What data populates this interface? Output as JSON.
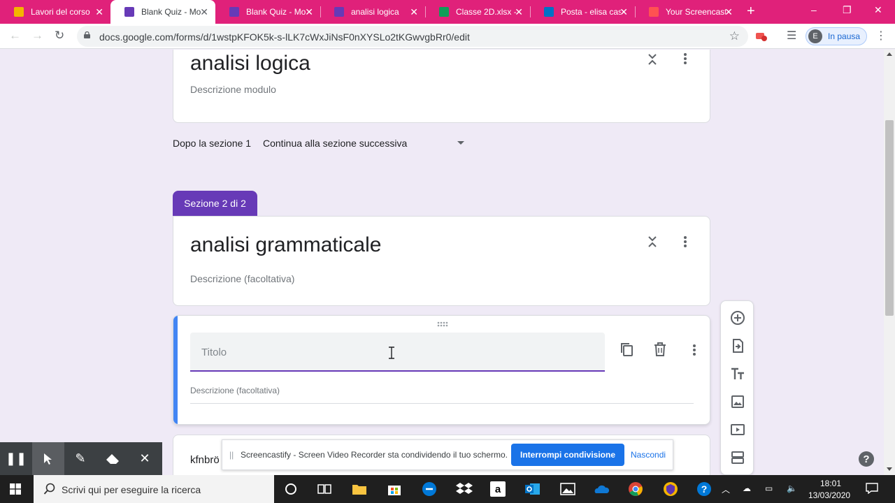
{
  "browser": {
    "tabs": [
      {
        "label": "Lavori del corso",
        "icon_color": "#f4b400"
      },
      {
        "label": "Blank Quiz - Mo",
        "icon_color": "#673ab7"
      },
      {
        "label": "Blank Quiz - Mo",
        "icon_color": "#673ab7"
      },
      {
        "label": "analisi logica",
        "icon_color": "#673ab7"
      },
      {
        "label": "Classe 2D.xlsx -",
        "icon_color": "#0f9d58"
      },
      {
        "label": "Posta - elisa cas",
        "icon_color": "#0072c6"
      },
      {
        "label": "Your Screencast",
        "icon_color": "#ff5252"
      }
    ],
    "new_tab_glyph": "+",
    "url": "docs.google.com/forms/d/1wstpKFOK5k-s-lLK7cWxJiNsF0nXYSLo2tKGwvgbRr0/edit",
    "profile_initial": "E",
    "profile_status": "In pausa",
    "accent_color": "#e0217a"
  },
  "form": {
    "section1": {
      "title": "analisi logica",
      "description_placeholder": "Descrizione modulo"
    },
    "after_section": {
      "label": "Dopo la sezione 1",
      "value": "Continua alla sezione successiva"
    },
    "section2": {
      "badge": "Sezione 2 di 2",
      "title": "analisi grammaticale",
      "description_placeholder": "Descrizione (facoltativa)"
    },
    "active_item": {
      "title_placeholder": "Titolo",
      "description_placeholder": "Descrizione (facoltativa)"
    },
    "next_item_text": "kfnbrö",
    "theme_color": "#673ab7",
    "active_bar_color": "#4285f4"
  },
  "toolbar_icons": [
    "add-question-icon",
    "import-questions-icon",
    "add-title-icon",
    "add-image-icon",
    "add-video-icon",
    "add-section-icon"
  ],
  "help_glyph": "?",
  "screencastify": {
    "message": "Screencastify - Screen Video Recorder sta condividendo il tuo schermo.",
    "stop_label": "Interrompi condivisione",
    "hide_label": "Nascondi"
  },
  "taskbar": {
    "search_placeholder": "Scrivi qui per eseguire la ricerca",
    "time": "18:01",
    "date": "13/03/2020"
  }
}
